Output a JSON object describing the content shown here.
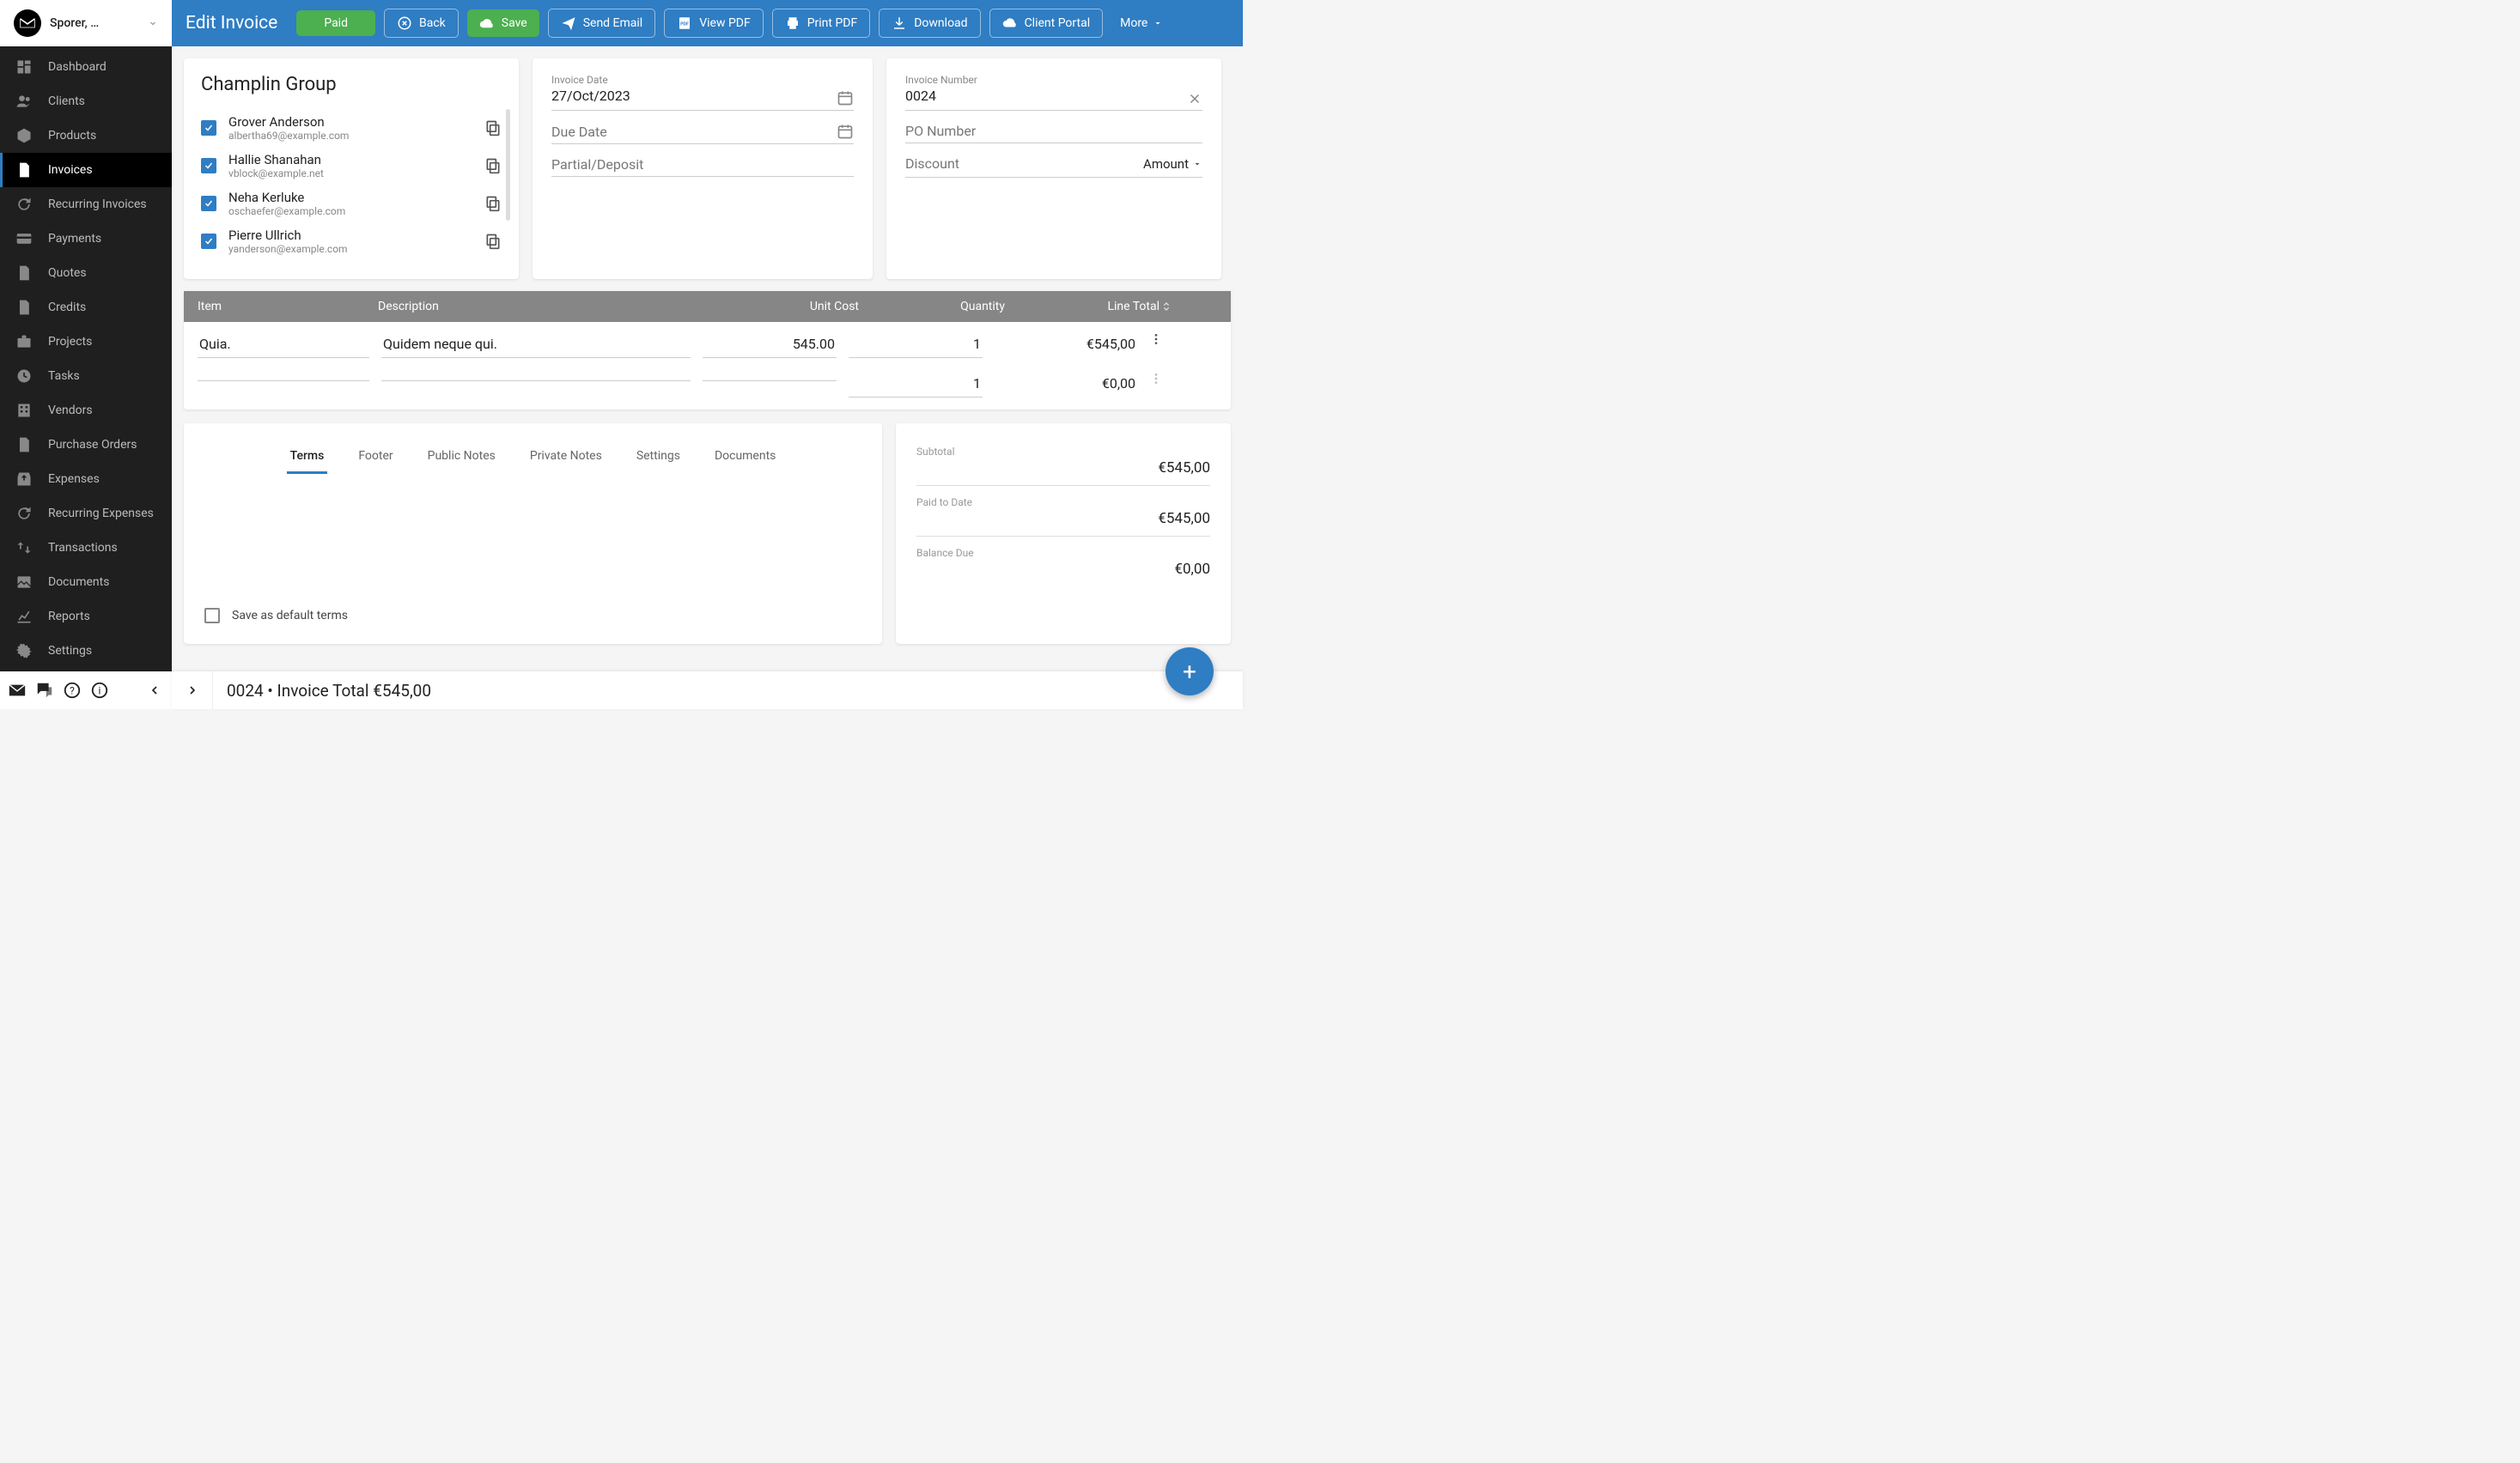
{
  "header": {
    "company": "Sporer, …"
  },
  "nav": {
    "items": [
      {
        "label": "Dashboard",
        "icon": "dashboard"
      },
      {
        "label": "Clients",
        "icon": "people"
      },
      {
        "label": "Products",
        "icon": "box"
      },
      {
        "label": "Invoices",
        "icon": "file",
        "active": true
      },
      {
        "label": "Recurring Invoices",
        "icon": "refresh"
      },
      {
        "label": "Payments",
        "icon": "card"
      },
      {
        "label": "Quotes",
        "icon": "file"
      },
      {
        "label": "Credits",
        "icon": "file"
      },
      {
        "label": "Projects",
        "icon": "briefcase"
      },
      {
        "label": "Tasks",
        "icon": "clock"
      },
      {
        "label": "Vendors",
        "icon": "building"
      },
      {
        "label": "Purchase Orders",
        "icon": "file"
      },
      {
        "label": "Expenses",
        "icon": "outbox"
      },
      {
        "label": "Recurring Expenses",
        "icon": "refresh"
      },
      {
        "label": "Transactions",
        "icon": "swap"
      },
      {
        "label": "Documents",
        "icon": "image"
      },
      {
        "label": "Reports",
        "icon": "chart"
      },
      {
        "label": "Settings",
        "icon": "gear"
      }
    ]
  },
  "topbar": {
    "title": "Edit Invoice",
    "paid": "Paid",
    "back": "Back",
    "save": "Save",
    "send_email": "Send Email",
    "view_pdf": "View PDF",
    "print_pdf": "Print PDF",
    "download": "Download",
    "client_portal": "Client Portal",
    "more": "More"
  },
  "client": {
    "name": "Champlin Group",
    "contacts": [
      {
        "name": "Grover Anderson",
        "email": "albertha69@example.com",
        "checked": true
      },
      {
        "name": "Hallie Shanahan",
        "email": "vblock@example.net",
        "checked": true
      },
      {
        "name": "Neha Kerluke",
        "email": "oschaefer@example.com",
        "checked": true
      },
      {
        "name": "Pierre Ullrich",
        "email": "yanderson@example.com",
        "checked": true
      }
    ]
  },
  "dates": {
    "invoice_date_label": "Invoice Date",
    "invoice_date": "27/Oct/2023",
    "due_date_label": "Due Date",
    "due_date": "",
    "partial_label": "Partial/Deposit",
    "partial": ""
  },
  "numbers": {
    "invoice_number_label": "Invoice Number",
    "invoice_number": "0024",
    "po_label": "PO Number",
    "po": "",
    "discount_label": "Discount",
    "discount": "",
    "discount_type": "Amount"
  },
  "items": {
    "headers": {
      "item": "Item",
      "desc": "Description",
      "unit": "Unit Cost",
      "qty": "Quantity",
      "total": "Line Total"
    },
    "rows": [
      {
        "item": "Quia.",
        "desc": "Quidem neque qui.",
        "unit": "545.00",
        "qty": "1",
        "total": "€545,00"
      },
      {
        "item": "",
        "desc": "",
        "unit": "",
        "qty": "1",
        "total": "€0,00"
      }
    ]
  },
  "tabs": {
    "list": [
      "Terms",
      "Footer",
      "Public Notes",
      "Private Notes",
      "Settings",
      "Documents"
    ],
    "active": "Terms",
    "save_default": "Save as default terms"
  },
  "totals": {
    "rows": [
      {
        "label": "Subtotal",
        "value": "€545,00"
      },
      {
        "label": "Paid to Date",
        "value": "€545,00"
      },
      {
        "label": "Balance Due",
        "value": "€0,00"
      }
    ]
  },
  "bottom": {
    "summary": "0024 • Invoice Total €545,00"
  }
}
